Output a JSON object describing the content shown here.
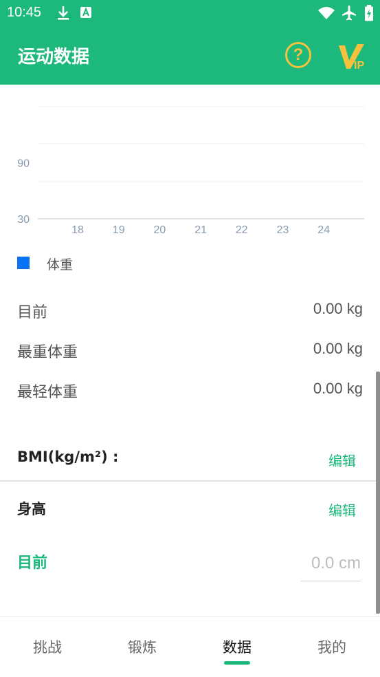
{
  "status_bar": {
    "time": "10:45",
    "icons": [
      "download-icon",
      "text-a-icon",
      "wifi-icon",
      "airplane-icon",
      "battery-charging-icon"
    ]
  },
  "app_bar": {
    "title": "运动数据",
    "help_icon": "question-circle-icon",
    "vip_icon": "vip-badge-icon",
    "accent_color": "#1db87b",
    "vip_color": "#f6c23e"
  },
  "chart_data": {
    "type": "line",
    "x": [
      "18",
      "19",
      "20",
      "21",
      "22",
      "23",
      "24"
    ],
    "y_ticks": [
      "90",
      "30"
    ],
    "ylim": [
      30,
      150
    ],
    "series": [
      {
        "name": "体重",
        "values": [],
        "color": "#0a72f5"
      }
    ],
    "grid": true,
    "legend_position": "bottom-left"
  },
  "weight_stats": [
    {
      "label": "目前",
      "value": "0.00 kg"
    },
    {
      "label": "最重体重",
      "value": "0.00 kg"
    },
    {
      "label": "最轻体重",
      "value": "0.00 kg"
    }
  ],
  "bmi": {
    "label": "BMI(kg/m²) :",
    "edit_label": "编辑"
  },
  "height": {
    "label": "身高",
    "edit_label": "编辑",
    "current_label": "目前",
    "placeholder": "0.0 cm"
  },
  "bottom_nav": {
    "items": [
      {
        "label": "挑战",
        "active": false
      },
      {
        "label": "锻炼",
        "active": false
      },
      {
        "label": "数据",
        "active": true
      },
      {
        "label": "我的",
        "active": false
      }
    ]
  }
}
